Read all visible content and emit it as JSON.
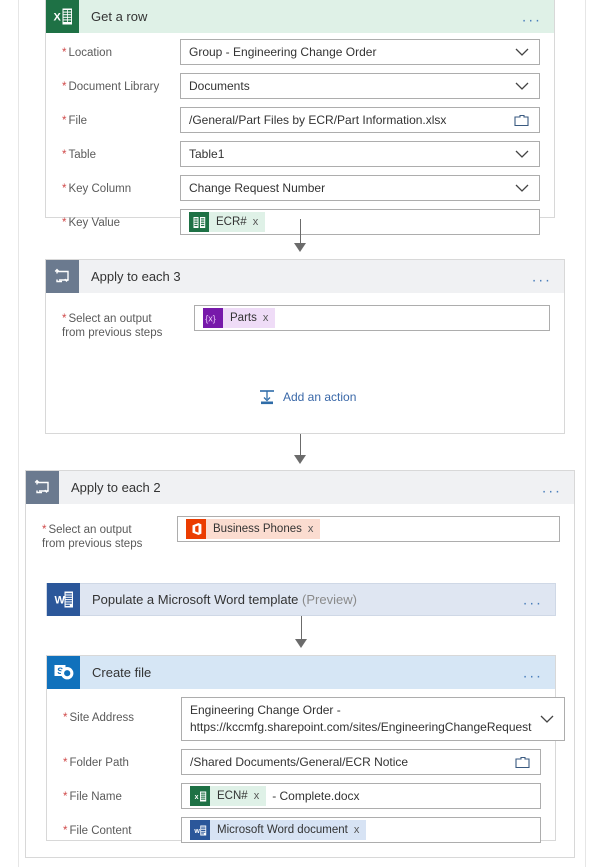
{
  "flow": {
    "steps": [
      {
        "id": "get-a-row",
        "title": "Get a row",
        "connector": "excel",
        "icon": "excel-icon",
        "overflow": "...",
        "fields": [
          {
            "label": "Location",
            "required": true,
            "value": "Group - Engineering Change Order",
            "control": "dropdown"
          },
          {
            "label": "Document Library",
            "required": true,
            "value": "Documents",
            "control": "dropdown"
          },
          {
            "label": "File",
            "required": true,
            "value": "/General/Part Files by ECR/Part Information.xlsx",
            "control": "filepicker"
          },
          {
            "label": "Table",
            "required": true,
            "value": "Table1",
            "control": "dropdown"
          },
          {
            "label": "Key Column",
            "required": true,
            "value": "Change Request Number",
            "control": "dropdown"
          },
          {
            "label": "Key Value",
            "required": true,
            "control": "token",
            "token": {
              "label": "ECR#",
              "icon": "excel-token-icon",
              "kind": "excel",
              "remove": "x"
            }
          }
        ]
      },
      {
        "id": "apply-to-each-3",
        "title": "Apply to each 3",
        "connector": "loop",
        "icon": "loop-icon",
        "overflow": "...",
        "fields": [
          {
            "label": "Select an output\nfrom previous steps",
            "required": true,
            "control": "token",
            "token": {
              "label": "Parts",
              "icon": "variable-icon",
              "kind": "variable",
              "remove": "x"
            }
          }
        ],
        "add_action": {
          "label": "Add an action",
          "icon": "add-action-icon"
        }
      },
      {
        "id": "apply-to-each-2",
        "title": "Apply to each 2",
        "connector": "loop",
        "icon": "loop-icon",
        "overflow": "...",
        "fields": [
          {
            "label": "Select an output\nfrom previous steps",
            "required": true,
            "control": "token",
            "token": {
              "label": "Business Phones",
              "icon": "office365-icon",
              "kind": "o365",
              "remove": "x"
            }
          }
        ],
        "children": [
          {
            "id": "populate-word-template",
            "title": "Populate a Microsoft Word template",
            "title_suffix": "(Preview)",
            "connector": "word",
            "icon": "word-icon",
            "overflow": "...",
            "collapsed": true
          },
          {
            "id": "create-file",
            "title": "Create file",
            "connector": "sharepoint",
            "icon": "sharepoint-icon",
            "overflow": "...",
            "fields": [
              {
                "label": "Site Address",
                "required": true,
                "value": "Engineering Change Order -\nhttps://kccmfg.sharepoint.com/sites/EngineeringChangeRequest",
                "control": "dropdown",
                "tall": true
              },
              {
                "label": "Folder Path",
                "required": true,
                "value": "/Shared Documents/General/ECR Notice",
                "control": "filepicker"
              },
              {
                "label": "File Name",
                "required": true,
                "control": "token",
                "token": {
                  "label": "ECN#",
                  "icon": "excel-token-icon",
                  "kind": "excel",
                  "remove": "x"
                },
                "suffix": "- Complete.docx"
              },
              {
                "label": "File Content",
                "required": true,
                "control": "token",
                "token": {
                  "label": "Microsoft Word document",
                  "icon": "word-token-icon",
                  "kind": "word",
                  "remove": "x"
                }
              }
            ]
          }
        ]
      }
    ]
  },
  "colors": {
    "excel_green": "#1e7145",
    "word_blue": "#2b579a",
    "sharepoint_blue": "#1071bc",
    "office365_orange": "#eb3c00",
    "variable_purple": "#7719aa",
    "loop_gray": "#6b7a8f",
    "required_red": "#d04a4a",
    "link_blue": "#3a68a8"
  }
}
